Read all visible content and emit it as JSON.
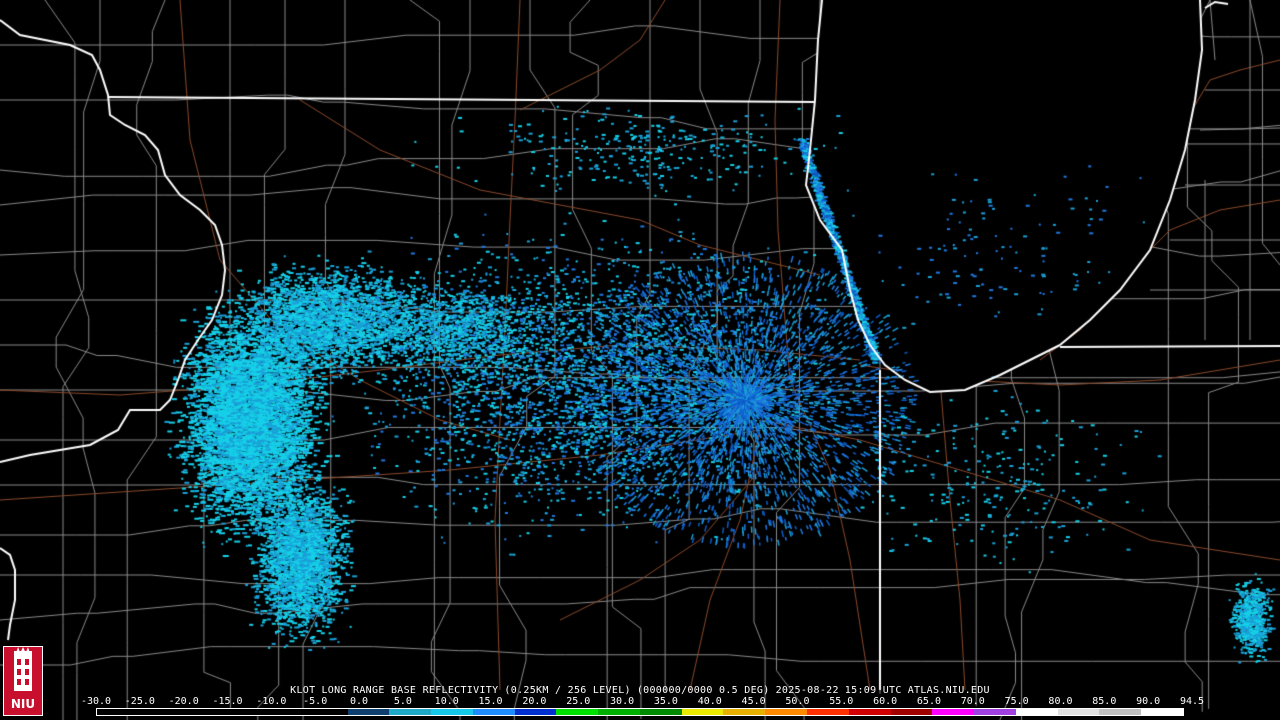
{
  "product": {
    "station": "KLOT",
    "name": "LONG RANGE BASE REFLECTIVITY",
    "resolution": "(0.25KM / 256 LEVEL)",
    "volume": "(000000/0000 0.5 DEG)",
    "date": "2025-08-22",
    "time": "15:09 UTC",
    "source": "ATLAS.NIU.EDU"
  },
  "scale": {
    "labels": [
      "-30.0",
      "-25.0",
      "-20.0",
      "-15.0",
      "-10.0",
      "-5.0",
      "0.0",
      "5.0",
      "10.0",
      "15.0",
      "20.0",
      "25.0",
      "30.0",
      "35.0",
      "40.0",
      "45.0",
      "50.0",
      "55.0",
      "60.0",
      "65.0",
      "70.0",
      "75.0",
      "80.0",
      "85.0",
      "90.0",
      "94.5"
    ],
    "colors": [
      "#000000",
      "#000000",
      "#000000",
      "#000000",
      "#000000",
      "#000000",
      "#0f3f6f",
      "#1fa8c8",
      "#16c8e8",
      "#1e8cff",
      "#0030d0",
      "#00e000",
      "#00b000",
      "#008a00",
      "#e8e800",
      "#e8b000",
      "#ff8a00",
      "#ff3000",
      "#d00000",
      "#a00000",
      "#ff00ff",
      "#a040e0",
      "#ffffff",
      "#e0e0e0",
      "#c0c0c0",
      "#ffffff"
    ]
  },
  "map": {
    "background": "#000000",
    "state_border_color": "#ffffff",
    "county_border_color": "#8a8a8a",
    "highway_color": "#8b4a2b",
    "echo_colors": [
      "#16d0e8",
      "#1aa0d8",
      "#1e78e0",
      "#0c5cc8"
    ]
  },
  "logo": {
    "text": "NIU"
  }
}
